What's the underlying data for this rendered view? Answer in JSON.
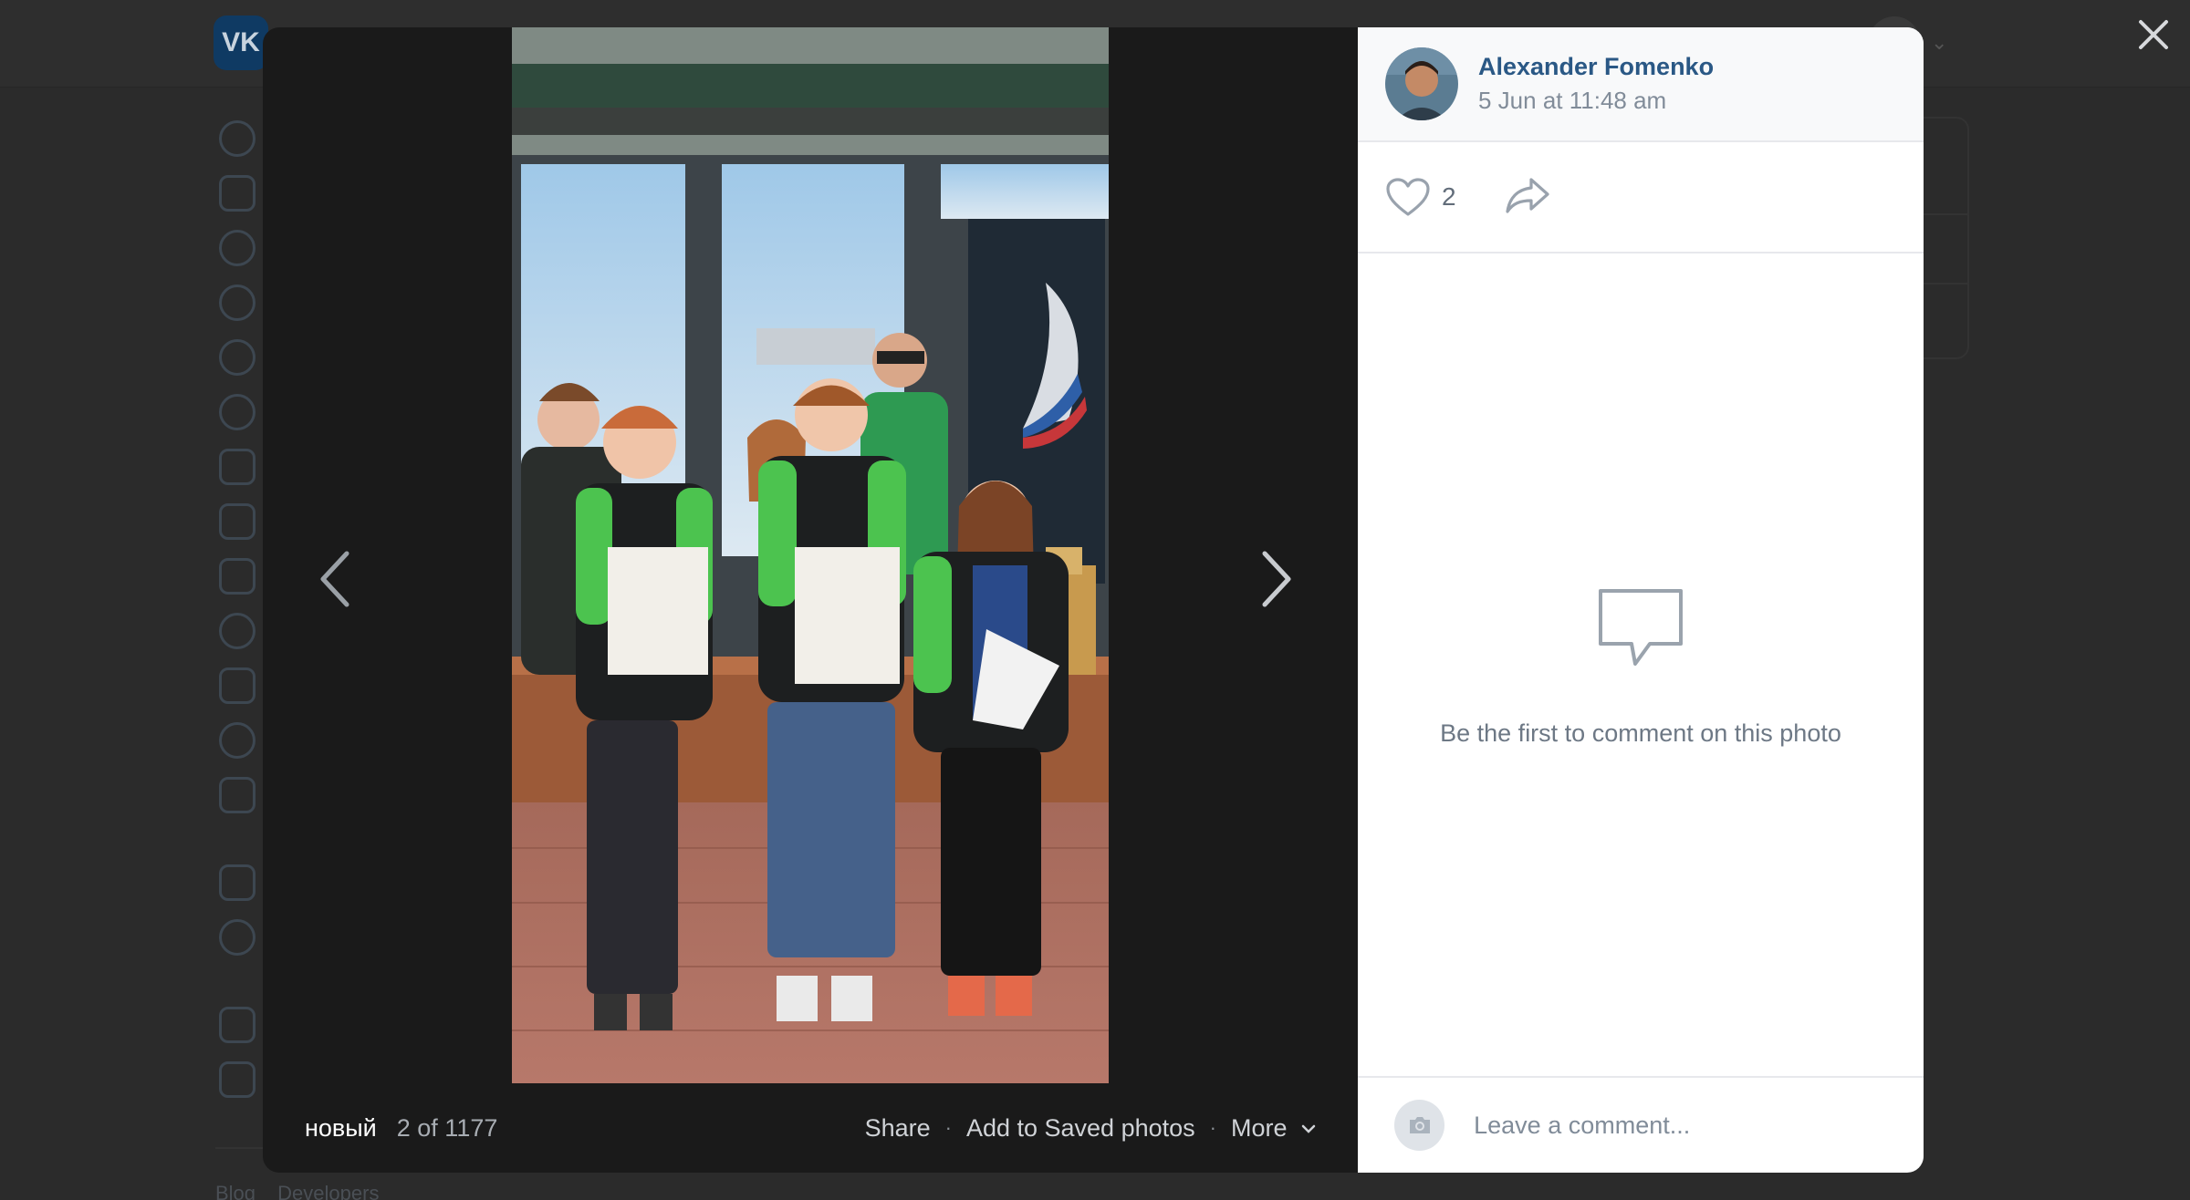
{
  "background": {
    "logo": "VK",
    "footer_links": [
      "Blog",
      "Developers"
    ]
  },
  "viewer": {
    "album_name": "новый",
    "counter": "2 of 1177",
    "actions": {
      "share": "Share",
      "save": "Add to Saved photos",
      "more": "More"
    }
  },
  "author": {
    "name": "Alexander Fomenko",
    "date": "5 Jun at 11:48 am"
  },
  "reactions": {
    "likes": "2"
  },
  "comments": {
    "empty_text": "Be the first to comment on this photo",
    "placeholder": "Leave a comment..."
  },
  "icons": [
    "vk-logo",
    "close-icon",
    "chevron-left-icon",
    "chevron-right-icon",
    "heart-icon",
    "share-arrow-icon",
    "comments-empty-icon",
    "camera-icon",
    "chevron-down-icon"
  ],
  "colors": {
    "author_link": "#2a5885",
    "muted_text": "#818c99",
    "overlay": "#2b2b2b"
  }
}
